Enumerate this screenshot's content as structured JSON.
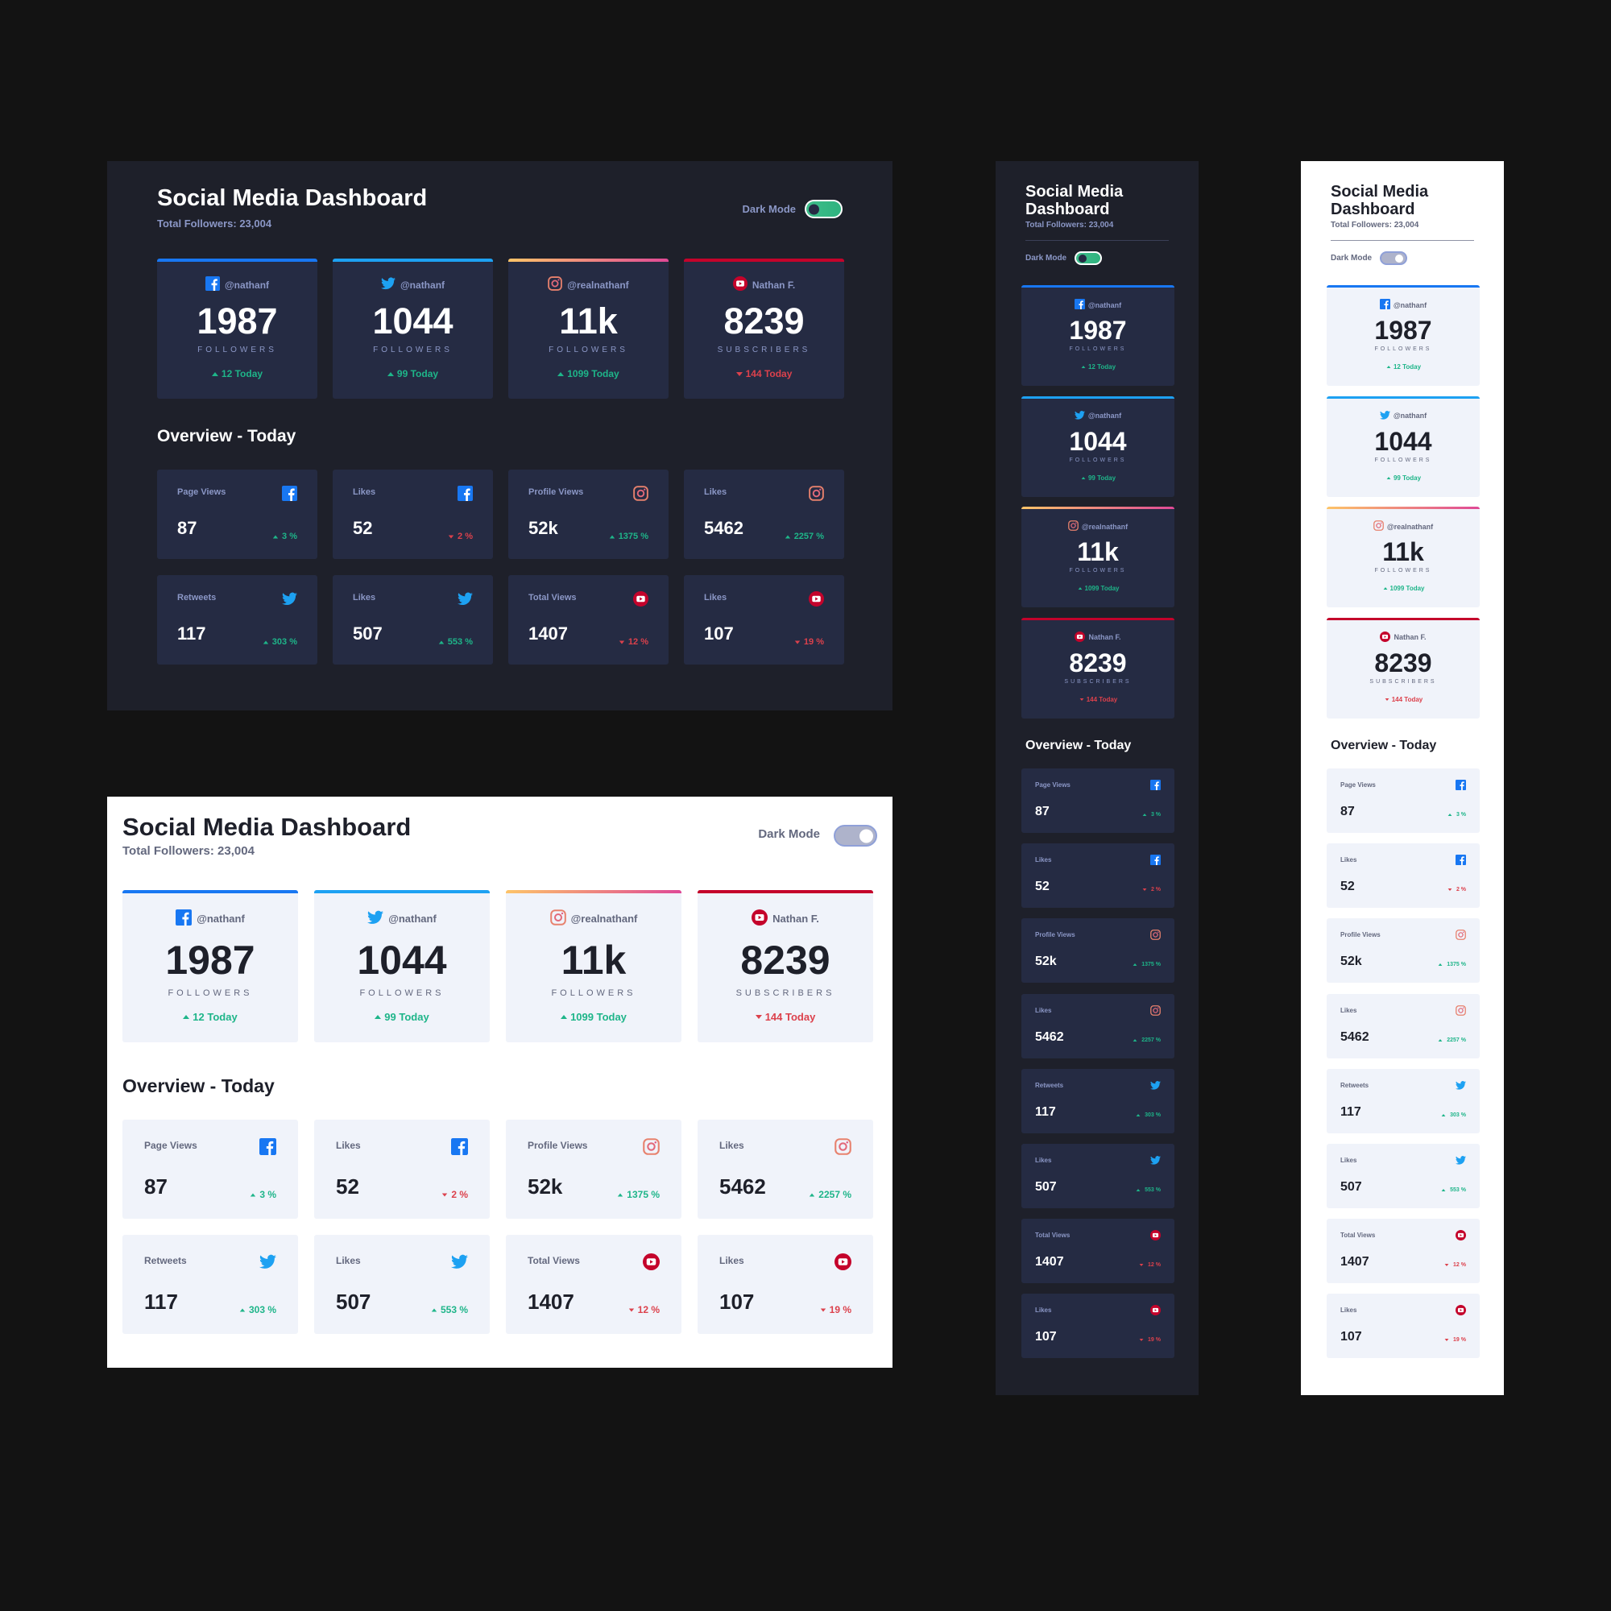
{
  "title": "Social Media Dashboard",
  "total": "Total Followers: 23,004",
  "dark_mode_label": "Dark Mode",
  "overview_title": "Overview - Today",
  "colors": {
    "facebook": "#1877f2",
    "twitter": "#1da1f2",
    "instagram": "#e1306c",
    "youtube": "#c4032b",
    "up": "#1eb589",
    "down": "#dc414c"
  },
  "followers": [
    {
      "platform": "facebook",
      "icon": "facebook-icon",
      "handle": "@nathanf",
      "count": "1987",
      "label": "Followers",
      "delta": "12 Today",
      "trend": "up"
    },
    {
      "platform": "twitter",
      "icon": "twitter-icon",
      "handle": "@nathanf",
      "count": "1044",
      "label": "Followers",
      "delta": "99 Today",
      "trend": "up"
    },
    {
      "platform": "instagram",
      "icon": "instagram-icon",
      "handle": "@realnathanf",
      "count": "11k",
      "label": "Followers",
      "delta": "1099 Today",
      "trend": "up"
    },
    {
      "platform": "youtube",
      "icon": "youtube-icon",
      "handle": "Nathan F.",
      "count": "8239",
      "label": "Subscribers",
      "delta": "144 Today",
      "trend": "down"
    }
  ],
  "overview": [
    {
      "platform": "facebook",
      "label": "Page Views",
      "value": "87",
      "pct": "3 %",
      "trend": "up"
    },
    {
      "platform": "facebook",
      "label": "Likes",
      "value": "52",
      "pct": "2 %",
      "trend": "down"
    },
    {
      "platform": "instagram",
      "label": "Profile Views",
      "value": "52k",
      "pct": "1375 %",
      "trend": "up"
    },
    {
      "platform": "instagram",
      "label": "Likes",
      "value": "5462",
      "pct": "2257 %",
      "trend": "up"
    },
    {
      "platform": "twitter",
      "label": "Retweets",
      "value": "117",
      "pct": "303 %",
      "trend": "up"
    },
    {
      "platform": "twitter",
      "label": "Likes",
      "value": "507",
      "pct": "553 %",
      "trend": "up"
    },
    {
      "platform": "youtube",
      "label": "Total Views",
      "value": "1407",
      "pct": "12 %",
      "trend": "down"
    },
    {
      "platform": "youtube",
      "label": "Likes",
      "value": "107",
      "pct": "19 %",
      "trend": "down"
    }
  ]
}
